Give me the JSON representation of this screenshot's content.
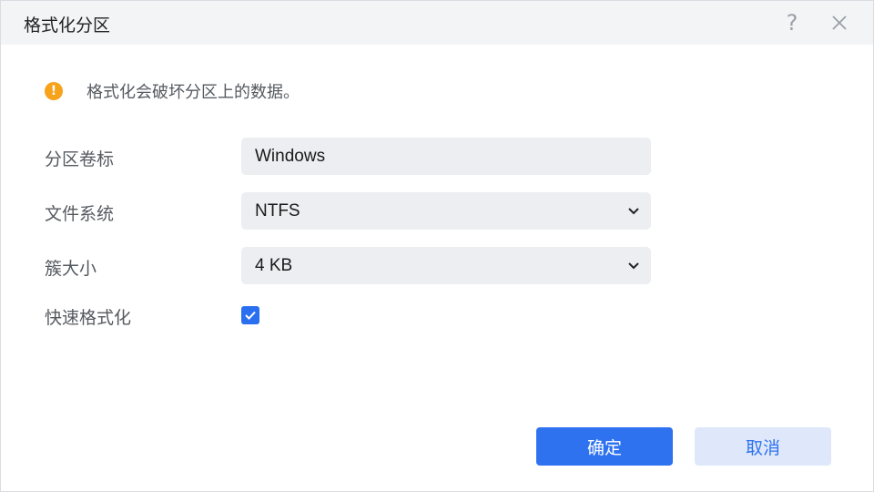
{
  "dialog": {
    "title": "格式化分区",
    "help_glyph": "?",
    "warning": "格式化会破坏分区上的数据。",
    "warning_glyph": "!"
  },
  "form": {
    "volume_label": {
      "label": "分区卷标",
      "value": "Windows"
    },
    "file_system": {
      "label": "文件系统",
      "value": "NTFS"
    },
    "cluster_size": {
      "label": "簇大小",
      "value": "4 KB"
    },
    "quick_format": {
      "label": "快速格式化",
      "checked": true
    }
  },
  "buttons": {
    "ok": "确定",
    "cancel": "取消"
  },
  "colors": {
    "primary": "#2e72f0",
    "warning": "#f7a21b",
    "field_bg": "#eceef2"
  }
}
